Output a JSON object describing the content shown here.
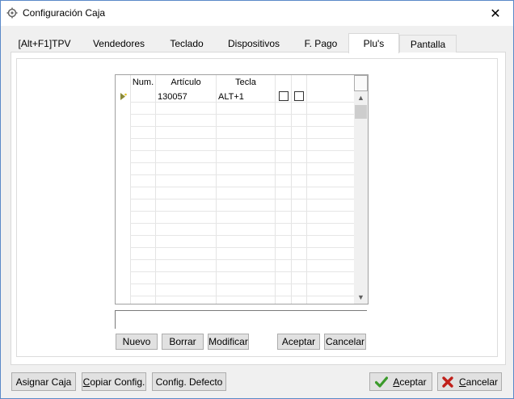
{
  "window": {
    "title": "Configuración Caja",
    "close_glyph": "✕",
    "title_icon": "settings-gear-icon"
  },
  "tabs": [
    {
      "label": "[Alt+F1]TPV",
      "selected": false
    },
    {
      "label": "Vendedores",
      "selected": false
    },
    {
      "label": "Teclado",
      "selected": false
    },
    {
      "label": "Dispositivos",
      "selected": false
    },
    {
      "label": "F. Pago",
      "selected": false
    },
    {
      "label": "Plu's",
      "selected": true
    },
    {
      "label": "Pantalla",
      "selected": false
    }
  ],
  "grid": {
    "columns": [
      "Num.",
      "Artículo",
      "Tecla",
      "",
      ""
    ],
    "rows": [
      {
        "num": "",
        "articulo": "130057",
        "tecla": "ALT+1",
        "check1": false,
        "check2": false
      }
    ],
    "row_indicator_icon": "new-row-star-icon",
    "scroll_up": "▲",
    "scroll_down": "▼"
  },
  "edit_field": {
    "value": ""
  },
  "grid_buttons": {
    "nuevo": "Nuevo",
    "borrar": "Borrar",
    "modificar": "Modificar",
    "aceptar": "Aceptar",
    "cancelar": "Cancelar"
  },
  "bottom_buttons": {
    "asignar_caja": "Asignar Caja",
    "copiar_config_first": "C",
    "copiar_config_rest": "opiar Config.",
    "config_defecto": "Config. Defecto",
    "aceptar_first": "A",
    "aceptar_rest": "ceptar",
    "cancelar_first": "C",
    "cancelar_rest": "ancelar"
  },
  "colors": {
    "window_border": "#5a89c8",
    "accept_icon": "#3a9a2a",
    "cancel_icon": "#c0201a"
  }
}
